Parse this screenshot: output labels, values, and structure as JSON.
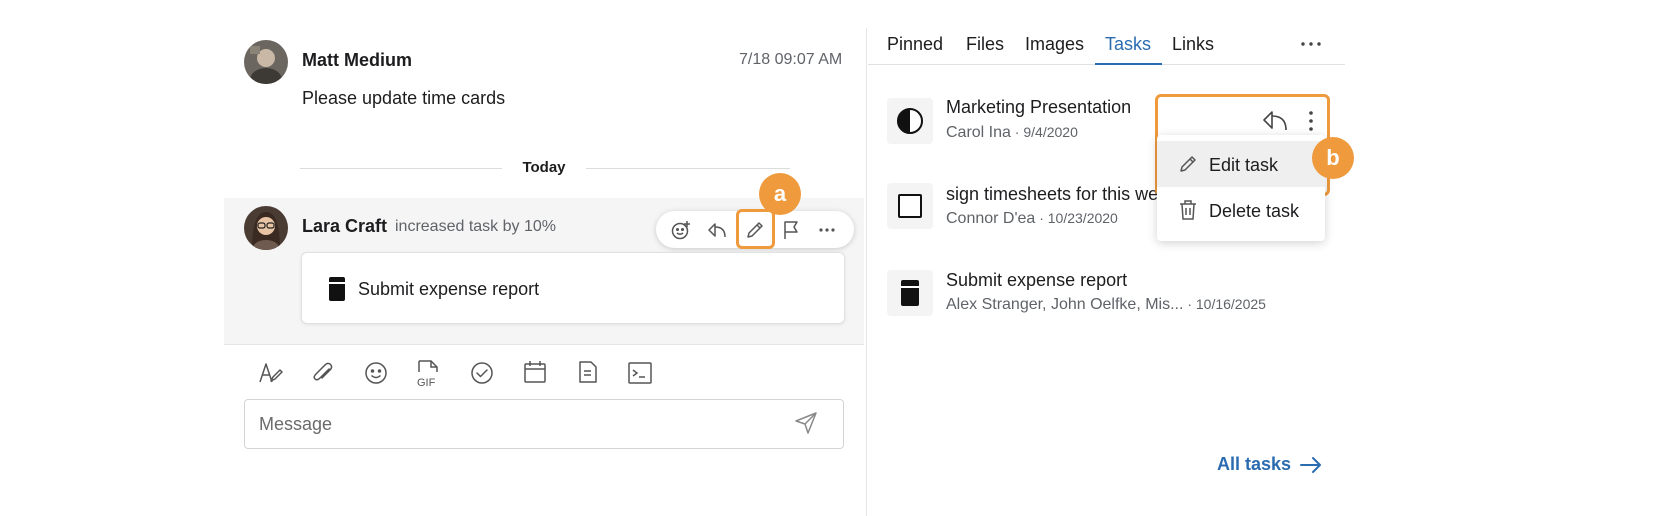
{
  "chat": {
    "messages": [
      {
        "sender": "Matt Medium",
        "timestamp": "7/18 09:07 AM",
        "text": "Please update time cards",
        "avatar_icon": "user-avatar-photo"
      },
      {
        "sender": "Lara Craft",
        "action": "increased task by 10%",
        "task_title": "Submit expense report",
        "avatar_icon": "user-avatar-photo"
      }
    ],
    "date_divider": "Today",
    "hover_toolbar": [
      "add-reaction-icon",
      "reply-icon",
      "edit-pencil-icon",
      "flag-icon",
      "more-horizontal-icon"
    ],
    "composer": {
      "placeholder": "Message",
      "toolbar_icons": [
        "text-format-icon",
        "attachment-icon",
        "emoji-icon",
        "gif-icon",
        "task-check-icon",
        "calendar-icon",
        "note-icon",
        "code-snippet-icon"
      ],
      "send_icon": "send-icon"
    }
  },
  "callouts": {
    "a": "a",
    "b": "b"
  },
  "side_panel": {
    "tabs": [
      {
        "label": "Pinned",
        "active": false
      },
      {
        "label": "Files",
        "active": false
      },
      {
        "label": "Images",
        "active": false
      },
      {
        "label": "Tasks",
        "active": true
      },
      {
        "label": "Links",
        "active": false
      }
    ],
    "more_icon": "more-horizontal-icon",
    "tasks": [
      {
        "title": "Marketing Presentation",
        "assignee": "Carol Ina",
        "date": " · 9/4/2020",
        "status_icon": "half-circle-progress-icon"
      },
      {
        "title": "sign timesheets for this we",
        "assignee": "Connor D'ea",
        "date": " · 10/23/2020",
        "status_icon": "empty-square-icon"
      },
      {
        "title": "Submit expense report",
        "assignee": "Alex Stranger, John Oelfke, Mis...",
        "date": " · 10/16/2025",
        "status_icon": "filled-progress-icon"
      }
    ],
    "task_menu": {
      "items": [
        {
          "label": "Edit task",
          "icon": "edit-pencil-icon"
        },
        {
          "label": "Delete task",
          "icon": "trash-icon"
        }
      ]
    },
    "all_tasks_link": "All tasks"
  },
  "colors": {
    "accent": "#2b6cb0",
    "callout": "#ef9a3d"
  }
}
